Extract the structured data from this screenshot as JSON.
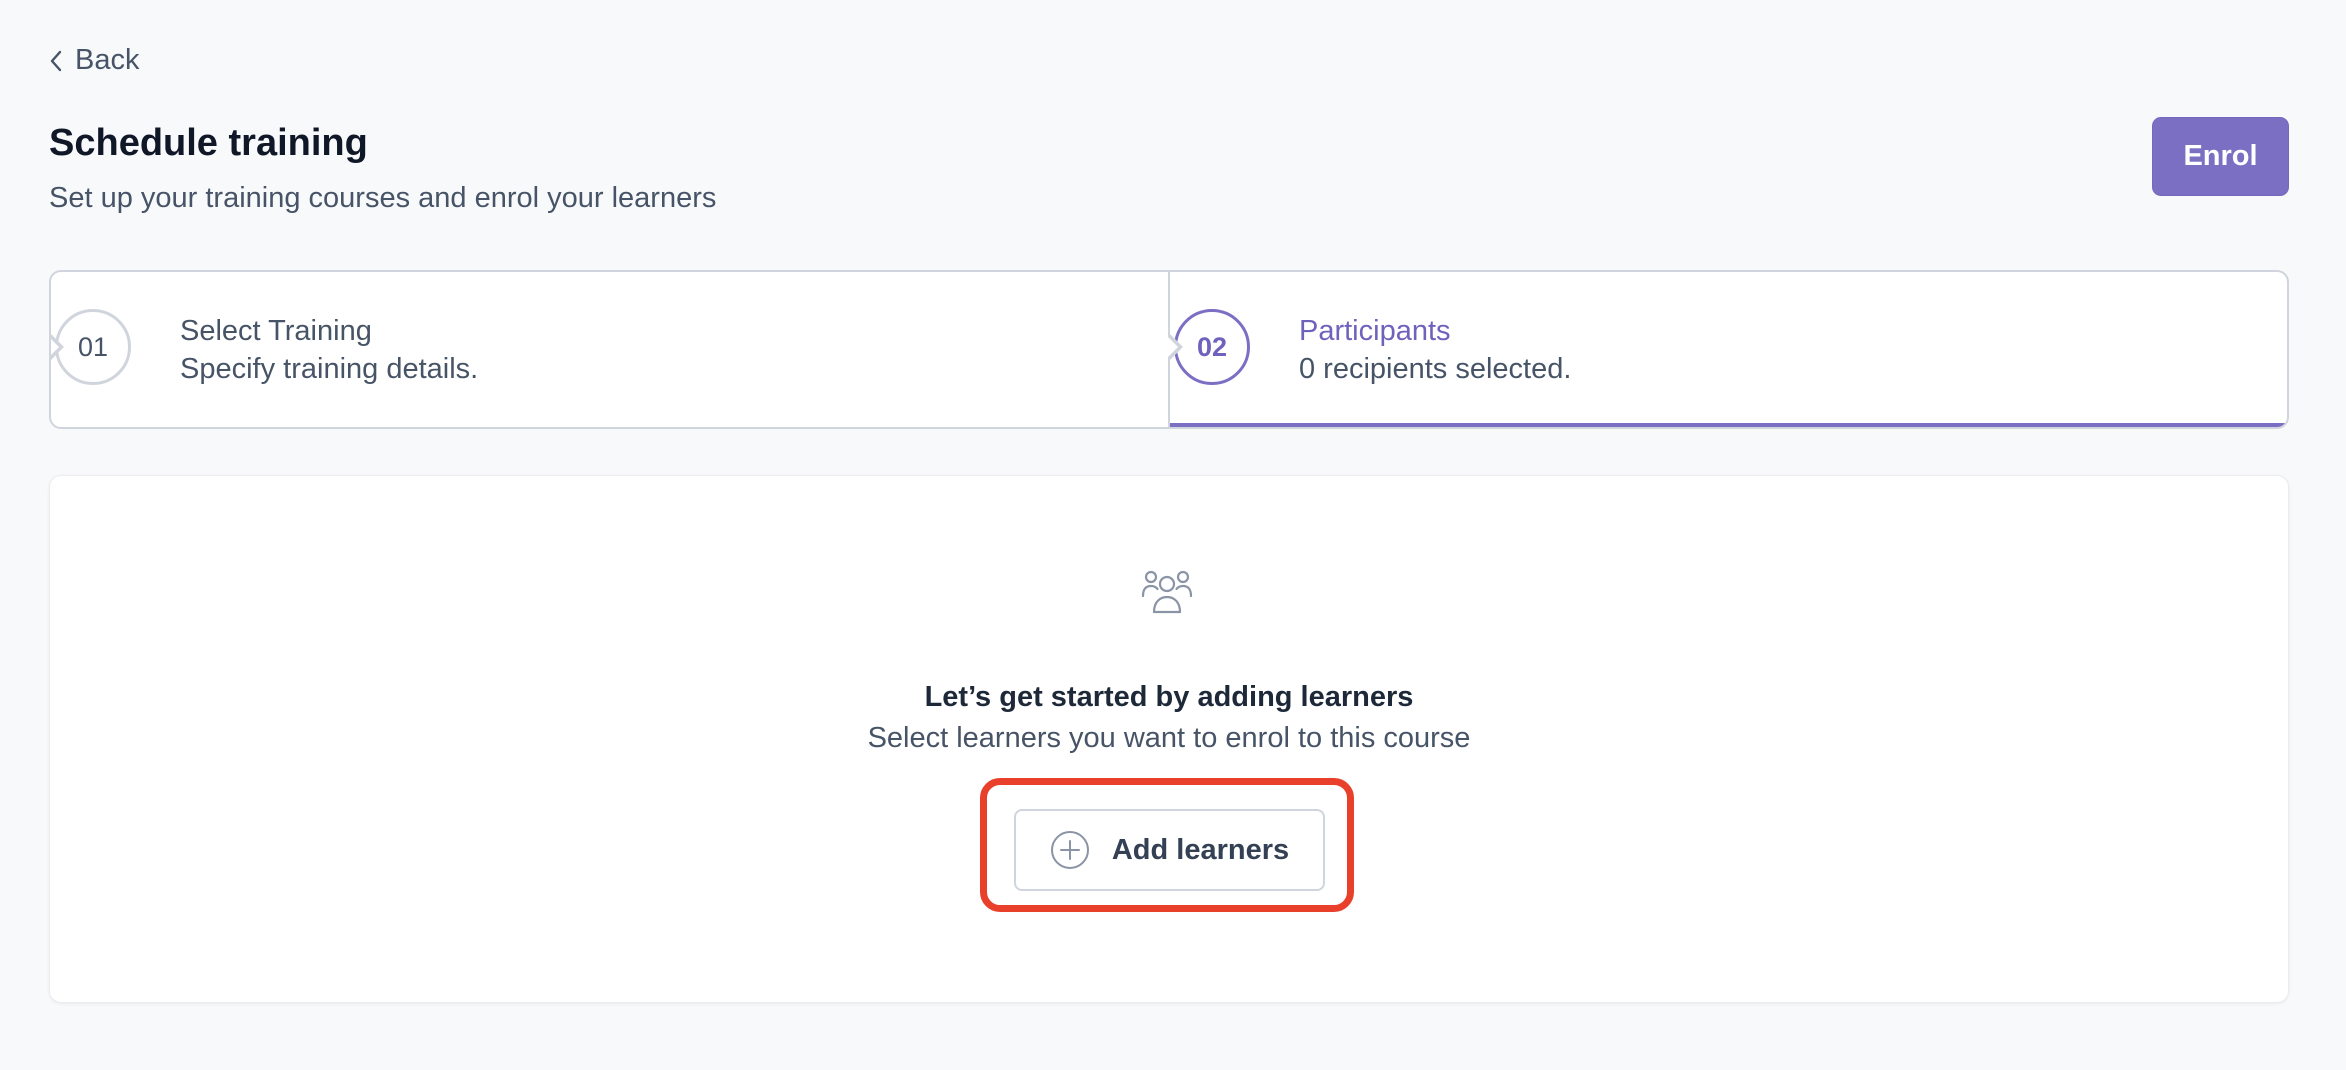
{
  "nav": {
    "back_label": "Back"
  },
  "header": {
    "title": "Schedule training",
    "subtitle": "Set up your training courses and enrol your learners",
    "enrol_label": "Enrol"
  },
  "stepper": {
    "steps": [
      {
        "number": "01",
        "title": "Select Training",
        "description": "Specify training details.",
        "active": false
      },
      {
        "number": "02",
        "title": "Participants",
        "description": "0 recipients selected.",
        "active": true
      }
    ]
  },
  "empty_state": {
    "icon": "users-group-icon",
    "title": "Let’s get started by adding learners",
    "description": "Select learners you want to enrol to this course",
    "add_button_label": "Add learners",
    "add_button_icon": "plus-circle-icon"
  },
  "colors": {
    "accent": "#7b6fc4",
    "highlight": "#e8402a",
    "border": "#d0d5dd",
    "background": "#f8f9fb"
  }
}
